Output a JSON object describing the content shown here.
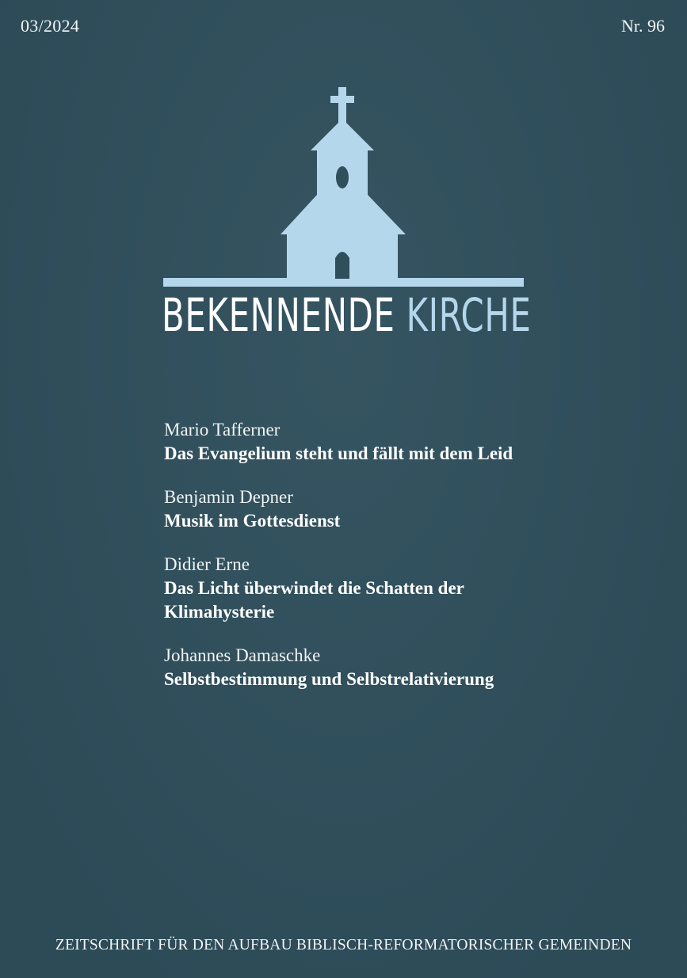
{
  "header": {
    "issue_date": "03/2024",
    "issue_number": "Nr. 96"
  },
  "logo": {
    "icon": "church-icon",
    "color": "#b5d7ec"
  },
  "masthead": {
    "word1": "BEKENNENDE",
    "word2": "KIRCHE"
  },
  "colors": {
    "background": "#2f4f5c",
    "accent": "#b5d7ec",
    "text": "#ffffff"
  },
  "articles": [
    {
      "author": "Mario Tafferner",
      "title": "Das Evangelium steht und fällt mit dem Leid"
    },
    {
      "author": "Benjamin Depner",
      "title": "Musik im Gottesdienst"
    },
    {
      "author": "Didier Erne",
      "title": "Das Licht überwindet die Schatten der Klimahysterie"
    },
    {
      "author": "Johannes Damaschke",
      "title": "Selbstbestimmung und Selbstrelativierung"
    }
  ],
  "footer": {
    "tagline": "ZEITSCHRIFT FÜR DEN AUFBAU BIBLISCH-REFORMATORISCHER GEMEINDEN"
  }
}
